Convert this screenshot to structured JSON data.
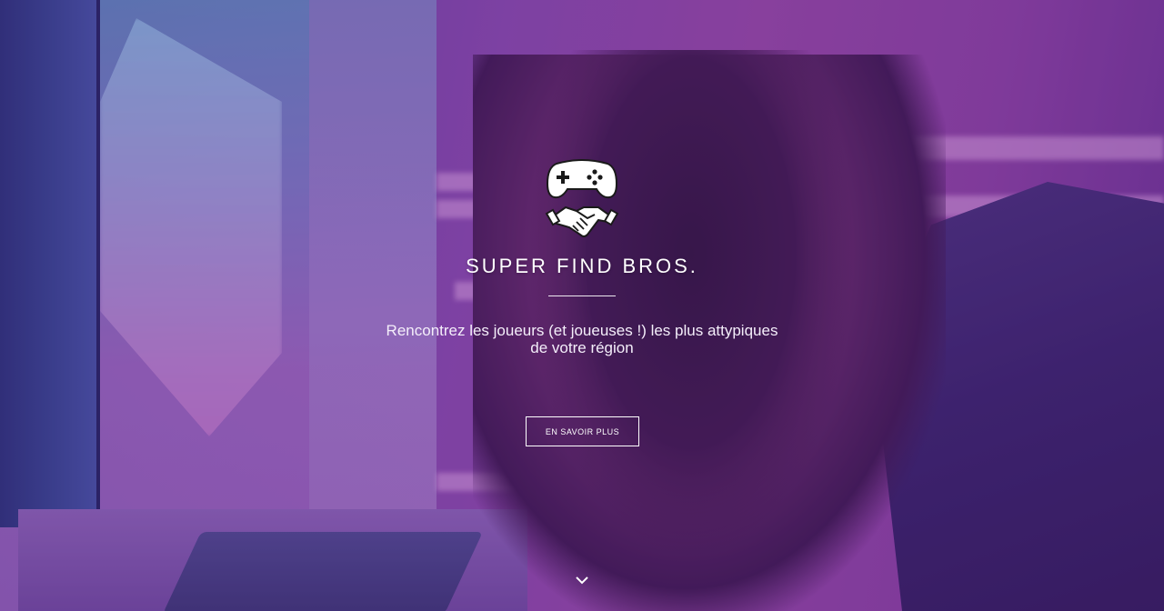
{
  "hero": {
    "brand_title": "SUPER FIND BROS.",
    "tagline": "Rencontrez les joueurs (et joueuses !) les plus attypiques de votre région",
    "cta_label": "EN SAVOIR PLUS",
    "logo_icons": [
      "gamepad-icon",
      "handshake-icon"
    ],
    "scroll_icon": "chevron-down-icon",
    "background_image": "gamer-girl-with-headset",
    "colors": {
      "text": "#ffffff",
      "overlay": "#5a1e82",
      "accent": "#9a4ea8"
    }
  }
}
